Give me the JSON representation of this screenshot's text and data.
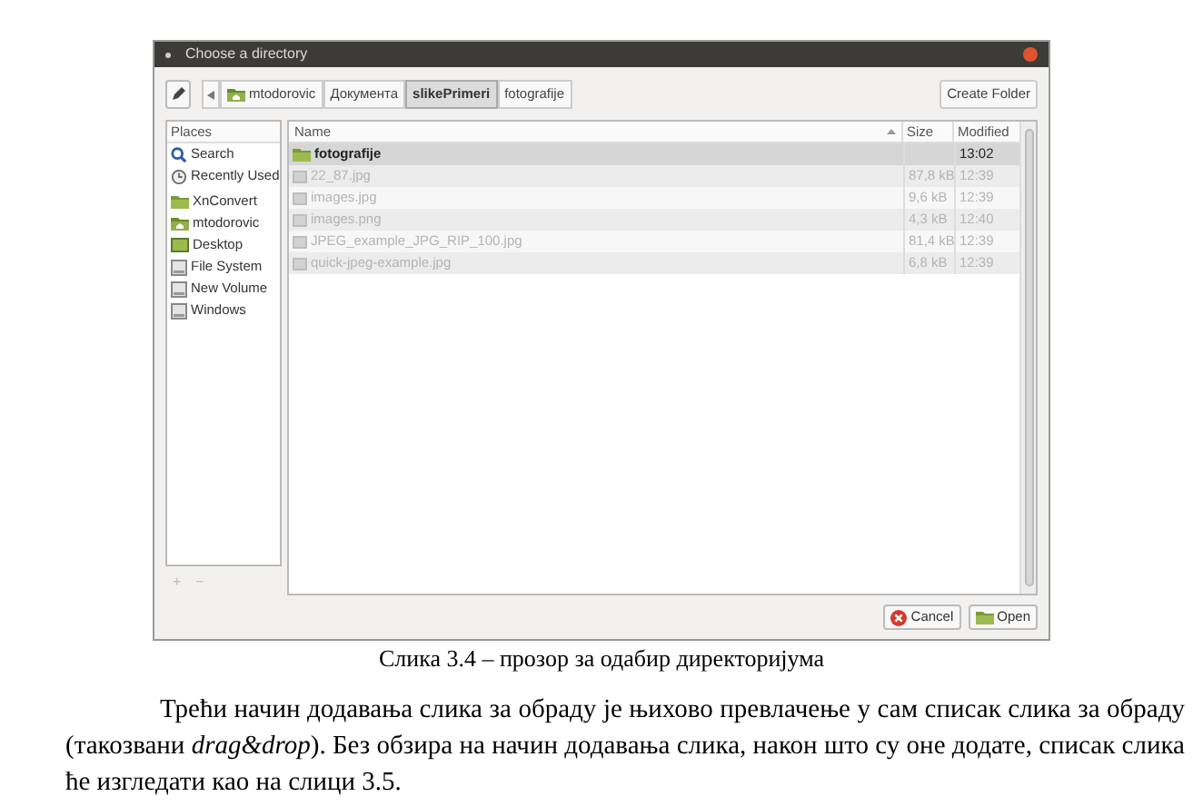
{
  "window": {
    "title": "Choose a directory"
  },
  "toolbar": {
    "path": [
      {
        "label": "mtodorovic",
        "kind": "home",
        "selected": false
      },
      {
        "label": "Документа",
        "kind": "plain",
        "selected": false
      },
      {
        "label": "slikePrimeri",
        "kind": "plain",
        "selected": true
      },
      {
        "label": "fotografije",
        "kind": "plain",
        "selected": false
      }
    ],
    "create_folder": "Create Folder"
  },
  "places": {
    "title": "Places",
    "items": [
      {
        "label": "Search",
        "kind": "search"
      },
      {
        "label": "Recently Used",
        "kind": "recent"
      },
      {
        "label": "XnConvert",
        "kind": "folder"
      },
      {
        "label": "mtodorovic",
        "kind": "home"
      },
      {
        "label": "Desktop",
        "kind": "desktop"
      },
      {
        "label": "File System",
        "kind": "drive"
      },
      {
        "label": "New Volume",
        "kind": "drive"
      },
      {
        "label": "Windows",
        "kind": "drive"
      }
    ],
    "add": "+",
    "remove": "−"
  },
  "table": {
    "columns": [
      "Name",
      "Size",
      "Modified"
    ],
    "rows": [
      {
        "name": "fotografije",
        "size": "",
        "modified": "13:02",
        "kind": "folder",
        "disabled": false,
        "selected": true
      },
      {
        "name": "22_87.jpg",
        "size": "87,8 kB",
        "modified": "12:39",
        "kind": "file",
        "disabled": true,
        "selected": false
      },
      {
        "name": "images.jpg",
        "size": "9,6 kB",
        "modified": "12:39",
        "kind": "file",
        "disabled": true,
        "selected": false
      },
      {
        "name": "images.png",
        "size": "4,3 kB",
        "modified": "12:40",
        "kind": "file",
        "disabled": true,
        "selected": false
      },
      {
        "name": "JPEG_example_JPG_RIP_100.jpg",
        "size": "81,4 kB",
        "modified": "12:39",
        "kind": "file",
        "disabled": true,
        "selected": false
      },
      {
        "name": "quick-jpeg-example.jpg",
        "size": "6,8 kB",
        "modified": "12:39",
        "kind": "file",
        "disabled": true,
        "selected": false
      }
    ]
  },
  "buttons": [
    {
      "label": "Cancel",
      "kind": "cancel"
    },
    {
      "label": "Open",
      "kind": "open"
    }
  ],
  "caption": "Слика 3.4 – прозор за одабир директоријума",
  "paragraph": "Трећи начин додавања слика за обраду је њихово превлачење у сам списак слика за обраду (такозвани *drag&drop*). Без обзира на начин додавања слика, након што су оне додате, списак слика ће изгледати као на слици 3.5."
}
